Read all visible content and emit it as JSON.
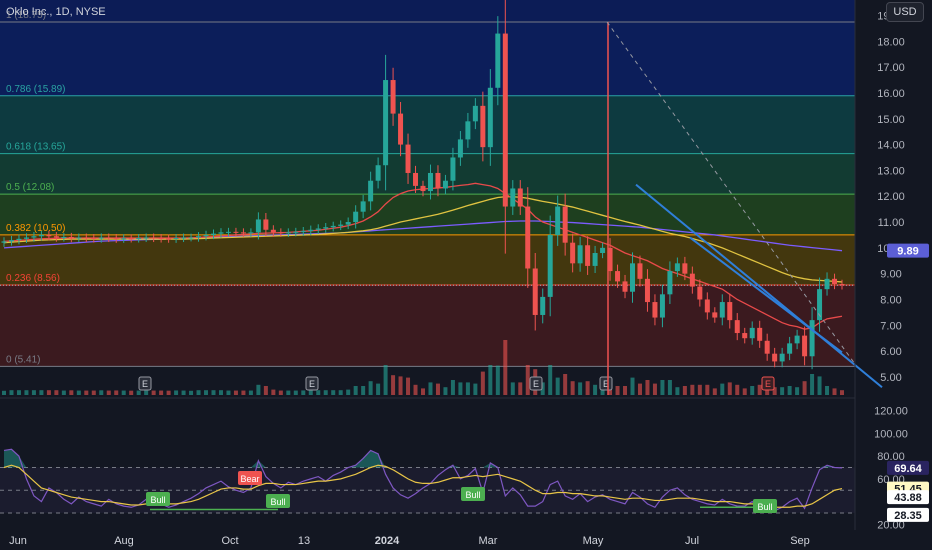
{
  "header": {
    "title": "Oklo Inc., 1D, NYSE",
    "currency_button": "USD"
  },
  "colors": {
    "background": "#131722",
    "candle_up": "#26a69a",
    "candle_down": "#ef5350",
    "ma_red": "#e84a4a",
    "ma_yellow": "#e0c341",
    "ma_purple": "#7b5cff",
    "trendline_blue": "#2f7fd9",
    "rsi_line": "#7e57c2",
    "rsi_ma": "#e8c547",
    "last_price_badge": "#5c5fd6"
  },
  "chart_data": [
    {
      "type": "candlestick",
      "name": "price",
      "ylim": [
        4.3,
        19.6
      ],
      "y_ticks": [
        "19.00",
        "18.00",
        "17.00",
        "16.00",
        "15.00",
        "14.00",
        "13.00",
        "12.00",
        "11.00",
        "10.00",
        "9.00",
        "8.00",
        "7.00",
        "6.00",
        "5.00"
      ],
      "x_ticks": [
        "Jun",
        "Aug",
        "Oct",
        "13",
        "2024",
        "Mar",
        "May",
        "Jul",
        "Sep"
      ],
      "last_price": 8.55,
      "price_badge": "9.89",
      "price_badge_value": 9.89,
      "fib_levels": [
        {
          "label": "1 (18.75)",
          "value": 18.75,
          "color": "#787b86",
          "fill": "#0c1e5a"
        },
        {
          "label": "0.786 (15.89)",
          "value": 15.89,
          "color": "#2aa3a3",
          "fill": "#0d3a40"
        },
        {
          "label": "0.618 (13.65)",
          "value": 13.65,
          "color": "#26a69a",
          "fill": "#123b32"
        },
        {
          "label": "0.5 (12.08)",
          "value": 12.08,
          "color": "#4caf50",
          "fill": "#1e3f1f"
        },
        {
          "label": "0.382 (10.50)",
          "value": 10.5,
          "color": "#ff9800",
          "fill": "#43370e"
        },
        {
          "label": "0.236 (8.56)",
          "value": 8.56,
          "color": "#f44336",
          "fill": "#3b1a1f"
        },
        {
          "label": "0 (5.41)",
          "value": 5.41,
          "color": "#787b86",
          "fill": null
        }
      ],
      "earnings_markers": [
        "E",
        "E",
        "E",
        "E",
        "E"
      ],
      "earnings_last_label": "E",
      "close_series": [
        10.25,
        10.3,
        10.35,
        10.4,
        10.45,
        10.5,
        10.45,
        10.4,
        10.42,
        10.38,
        10.4,
        10.38,
        10.36,
        10.4,
        10.38,
        10.35,
        10.37,
        10.36,
        10.38,
        10.4,
        10.38,
        10.36,
        10.35,
        10.38,
        10.4,
        10.4,
        10.45,
        10.5,
        10.55,
        10.6,
        10.62,
        10.6,
        10.58,
        10.6,
        11.1,
        10.7,
        10.6,
        10.58,
        10.6,
        10.62,
        10.65,
        10.7,
        10.75,
        10.8,
        10.85,
        10.9,
        11.0,
        11.4,
        11.8,
        12.6,
        13.2,
        16.5,
        15.2,
        14.0,
        12.9,
        12.4,
        12.2,
        12.9,
        12.3,
        12.6,
        13.5,
        14.2,
        14.9,
        15.5,
        13.9,
        16.2,
        18.3,
        11.6,
        12.3,
        11.6,
        9.2,
        7.4,
        8.1,
        10.5,
        11.6,
        10.2,
        9.4,
        10.1,
        9.3,
        9.8,
        10.0,
        9.1,
        8.7,
        8.3,
        9.4,
        8.8,
        7.9,
        7.3,
        8.2,
        9.1,
        9.4,
        9.0,
        8.5,
        8.0,
        7.5,
        7.3,
        7.9,
        7.2,
        6.7,
        6.5,
        6.9,
        6.4,
        5.9,
        5.6,
        5.9,
        6.3,
        6.6,
        5.8,
        7.2,
        8.4,
        8.8,
        8.6,
        8.55
      ],
      "ma_red": [
        10.25,
        10.27,
        10.29,
        10.31,
        10.33,
        10.35,
        10.36,
        10.37,
        10.38,
        10.38,
        10.38,
        10.38,
        10.38,
        10.38,
        10.38,
        10.38,
        10.38,
        10.38,
        10.38,
        10.38,
        10.38,
        10.38,
        10.38,
        10.38,
        10.38,
        10.39,
        10.4,
        10.42,
        10.44,
        10.46,
        10.48,
        10.5,
        10.52,
        10.54,
        10.56,
        10.57,
        10.58,
        10.59,
        10.6,
        10.62,
        10.64,
        10.66,
        10.68,
        10.72,
        10.76,
        10.8,
        10.86,
        10.94,
        11.04,
        11.2,
        11.4,
        11.7,
        11.95,
        12.1,
        12.2,
        12.25,
        12.28,
        12.3,
        12.32,
        12.34,
        12.38,
        12.42,
        12.45,
        12.5,
        12.45,
        12.4,
        12.3,
        12.1,
        11.9,
        11.7,
        11.5,
        11.2,
        11.0,
        10.9,
        10.8,
        10.7,
        10.6,
        10.5,
        10.4,
        10.3,
        10.2,
        10.1,
        9.95,
        9.8,
        9.7,
        9.6,
        9.5,
        9.35,
        9.2,
        9.1,
        9.0,
        8.9,
        8.8,
        8.7,
        8.6,
        8.5,
        8.4,
        8.2,
        8.0,
        7.85,
        7.7,
        7.55,
        7.4,
        7.25,
        7.1,
        7.0,
        6.95,
        6.85,
        6.9,
        7.1,
        7.25,
        7.3,
        7.35
      ],
      "ma_yellow": [
        10.2,
        10.22,
        10.24,
        10.26,
        10.28,
        10.3,
        10.31,
        10.32,
        10.33,
        10.34,
        10.34,
        10.34,
        10.34,
        10.34,
        10.34,
        10.34,
        10.34,
        10.34,
        10.34,
        10.34,
        10.34,
        10.34,
        10.34,
        10.34,
        10.34,
        10.35,
        10.36,
        10.37,
        10.38,
        10.39,
        10.4,
        10.41,
        10.42,
        10.43,
        10.44,
        10.45,
        10.46,
        10.47,
        10.48,
        10.49,
        10.5,
        10.51,
        10.52,
        10.54,
        10.56,
        10.58,
        10.6,
        10.63,
        10.66,
        10.7,
        10.76,
        10.84,
        10.92,
        11.0,
        11.06,
        11.12,
        11.18,
        11.24,
        11.3,
        11.38,
        11.46,
        11.55,
        11.64,
        11.72,
        11.8,
        11.88,
        11.95,
        11.98,
        11.98,
        11.96,
        11.92,
        11.86,
        11.8,
        11.75,
        11.7,
        11.64,
        11.58,
        11.5,
        11.42,
        11.34,
        11.26,
        11.18,
        11.1,
        11.02,
        10.95,
        10.88,
        10.8,
        10.72,
        10.64,
        10.56,
        10.5,
        10.44,
        10.36,
        10.28,
        10.2,
        10.1,
        10.0,
        9.88,
        9.76,
        9.64,
        9.52,
        9.4,
        9.28,
        9.16,
        9.04,
        8.94,
        8.86,
        8.8,
        8.76,
        8.74,
        8.72,
        8.7,
        8.68
      ],
      "ma_purple": [
        10.0,
        10.02,
        10.04,
        10.06,
        10.08,
        10.1,
        10.12,
        10.14,
        10.16,
        10.18,
        10.2,
        10.22,
        10.24,
        10.26,
        10.27,
        10.28,
        10.29,
        10.3,
        10.31,
        10.32,
        10.33,
        10.34,
        10.35,
        10.36,
        10.37,
        10.38,
        10.39,
        10.4,
        10.41,
        10.42,
        10.43,
        10.44,
        10.45,
        10.46,
        10.47,
        10.48,
        10.49,
        10.5,
        10.51,
        10.52,
        10.53,
        10.54,
        10.55,
        10.56,
        10.57,
        10.58,
        10.6,
        10.62,
        10.64,
        10.66,
        10.68,
        10.7,
        10.72,
        10.74,
        10.76,
        10.78,
        10.8,
        10.82,
        10.84,
        10.86,
        10.88,
        10.9,
        10.92,
        10.94,
        10.96,
        10.98,
        11.0,
        11.02,
        11.03,
        11.04,
        11.04,
        11.04,
        11.03,
        11.02,
        11.0,
        10.99,
        10.98,
        10.96,
        10.94,
        10.92,
        10.9,
        10.88,
        10.86,
        10.84,
        10.82,
        10.8,
        10.77,
        10.74,
        10.71,
        10.68,
        10.65,
        10.62,
        10.59,
        10.56,
        10.53,
        10.5,
        10.46,
        10.42,
        10.38,
        10.34,
        10.3,
        10.26,
        10.22,
        10.18,
        10.14,
        10.1,
        10.07,
        10.04,
        10.01,
        9.98,
        9.95,
        9.92,
        9.89
      ]
    },
    {
      "type": "line",
      "name": "RSI",
      "ylim": [
        15,
        125
      ],
      "y_ticks": [
        "120.00",
        "100.00",
        "80.00",
        "60.00",
        "20.00"
      ],
      "levels": [
        70,
        50,
        30
      ],
      "badges": [
        "69.64",
        "51.45",
        "43.88",
        "28.35"
      ],
      "badge_values": [
        69.64,
        51.45,
        43.88,
        28.35
      ],
      "signal_labels": [
        "Bull",
        "Bear",
        "Bull",
        "Bull",
        "Bull"
      ],
      "rsi": [
        85,
        86,
        80,
        60,
        45,
        40,
        52,
        48,
        42,
        38,
        44,
        40,
        38,
        36,
        42,
        38,
        36,
        35,
        37,
        42,
        40,
        38,
        35,
        37,
        40,
        43,
        47,
        52,
        55,
        58,
        53,
        50,
        48,
        52,
        76,
        62,
        56,
        52,
        57,
        55,
        58,
        60,
        62,
        58,
        63,
        66,
        70,
        72,
        78,
        85,
        82,
        64,
        52,
        46,
        43,
        47,
        52,
        56,
        63,
        68,
        72,
        60,
        63,
        69,
        48,
        74,
        70,
        45,
        52,
        46,
        36,
        36,
        40,
        55,
        58,
        45,
        42,
        47,
        40,
        44,
        46,
        42,
        40,
        38,
        48,
        44,
        38,
        35,
        44,
        50,
        52,
        46,
        42,
        40,
        38,
        37,
        42,
        38,
        36,
        36,
        40,
        35,
        33,
        32,
        35,
        40,
        43,
        34,
        52,
        68,
        72,
        70,
        69.64
      ],
      "rsi_ma": [
        70,
        72,
        70,
        64,
        58,
        52,
        50,
        48,
        46,
        44,
        43,
        42,
        41,
        40,
        40,
        39,
        38,
        37,
        37,
        38,
        39,
        39,
        38,
        38,
        39,
        40,
        42,
        45,
        48,
        51,
        52,
        52,
        51,
        51,
        54,
        56,
        56,
        55,
        55,
        55,
        56,
        57,
        58,
        58,
        59,
        60,
        62,
        64,
        67,
        70,
        72,
        71,
        68,
        64,
        60,
        57,
        56,
        56,
        57,
        59,
        61,
        61,
        62,
        63,
        62,
        63,
        64,
        62,
        60,
        58,
        54,
        50,
        47,
        47,
        48,
        48,
        47,
        47,
        46,
        45,
        45,
        44,
        43,
        42,
        43,
        43,
        42,
        41,
        41,
        42,
        43,
        43,
        43,
        42,
        41,
        40,
        40,
        40,
        39,
        38,
        38,
        37,
        36,
        35,
        35,
        35,
        36,
        36,
        38,
        42,
        46,
        50,
        51.45
      ]
    }
  ]
}
